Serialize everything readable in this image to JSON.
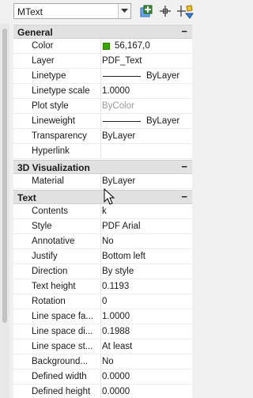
{
  "toolbar": {
    "object_type": "MText",
    "icons": [
      "toggle-pickadd-icon",
      "select-objects-icon",
      "quick-select-icon"
    ]
  },
  "sections": [
    {
      "title": "General",
      "collapse_symbol": "−",
      "rows": [
        {
          "label": "Color",
          "value": "56,167,0",
          "swatch_color": "#38a700"
        },
        {
          "label": "Layer",
          "value": "PDF_Text"
        },
        {
          "label": "Linetype",
          "value": "ByLayer",
          "line_sample": true
        },
        {
          "label": "Linetype scale",
          "value": "1.0000"
        },
        {
          "label": "Plot style",
          "value": "ByColor",
          "disabled": true
        },
        {
          "label": "Lineweight",
          "value": "ByLayer",
          "line_sample": true
        },
        {
          "label": "Transparency",
          "value": "ByLayer"
        },
        {
          "label": "Hyperlink",
          "value": ""
        }
      ]
    },
    {
      "title": "3D Visualization",
      "collapse_symbol": "−",
      "rows": [
        {
          "label": "Material",
          "value": "ByLayer"
        }
      ]
    },
    {
      "title": "Text",
      "collapse_symbol": "−",
      "rows": [
        {
          "label": "Contents",
          "value": "k"
        },
        {
          "label": "Style",
          "value": "PDF Arial"
        },
        {
          "label": "Annotative",
          "value": "No"
        },
        {
          "label": "Justify",
          "value": "Bottom left"
        },
        {
          "label": "Direction",
          "value": "By style"
        },
        {
          "label": "Text height",
          "value": "0.1193"
        },
        {
          "label": "Rotation",
          "value": "0"
        },
        {
          "label": "Line space fa...",
          "value": "1.0000"
        },
        {
          "label": "Line space di...",
          "value": "0.1988"
        },
        {
          "label": "Line space st...",
          "value": "At least"
        },
        {
          "label": "Background...",
          "value": "No"
        },
        {
          "label": "Defined width",
          "value": "0.0000"
        },
        {
          "label": "Defined height",
          "value": "0.0000"
        }
      ]
    }
  ],
  "colors": {
    "section_header_bg": "#e1e1e1",
    "swatch": "#38a700",
    "disabled_text": "#9a9a9a"
  }
}
